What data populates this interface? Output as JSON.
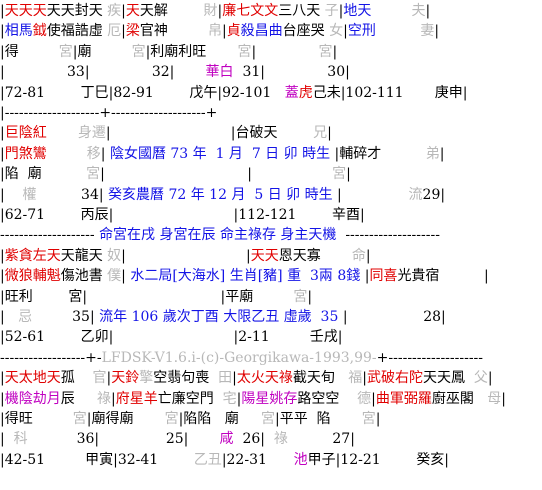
{
  "colors": {
    "red": "#e00000",
    "blue": "#1414e6",
    "green": "#00a000",
    "magenta": "#c000c0",
    "grey": "#b8b8b8",
    "black": "#000000"
  },
  "rows": [
    {
      "t": "━",
      "segs": [
        [
          "",
          "k"
        ]
      ]
    },
    {
      "segs": [
        [
          "|",
          "k"
        ],
        [
          "天天天",
          "r"
        ],
        [
          "天天封天 ",
          "k"
        ],
        [
          "疾",
          "g"
        ],
        [
          "|",
          "k"
        ],
        [
          "天",
          "r"
        ],
        [
          "天解        ",
          "k"
        ],
        [
          "財",
          "g"
        ],
        [
          "|",
          "k"
        ],
        [
          "廉七文文",
          "r"
        ],
        [
          "三八天 ",
          "k"
        ],
        [
          "子",
          "g"
        ],
        [
          "|",
          "k"
        ],
        [
          "地天         ",
          "b"
        ],
        [
          "夫",
          "g"
        ],
        [
          "|",
          "k"
        ]
      ]
    },
    {
      "segs": [
        [
          "|",
          "k"
        ],
        [
          "相馬",
          "b"
        ],
        [
          "鉞",
          "r"
        ],
        [
          "使福誥虛 ",
          "k"
        ],
        [
          "厄",
          "g"
        ],
        [
          "|",
          "k"
        ],
        [
          "梁",
          "r"
        ],
        [
          "官神         ",
          "k"
        ],
        [
          "帛",
          "g"
        ],
        [
          "|",
          "k"
        ],
        [
          "貞",
          "r"
        ],
        [
          "殺昌曲",
          "b"
        ],
        [
          "台座哭 ",
          "k"
        ],
        [
          "女",
          "g"
        ],
        [
          "|",
          "k"
        ],
        [
          "空刑          ",
          "b"
        ],
        [
          "妻",
          "g"
        ],
        [
          "|",
          "k"
        ]
      ]
    },
    {
      "segs": [
        [
          "|得         ",
          "k"
        ],
        [
          "宮",
          "g"
        ],
        [
          "|廟         ",
          "k"
        ],
        [
          "宮",
          "g"
        ],
        [
          "|利廟利旺       ",
          "k"
        ],
        [
          "宮",
          "g"
        ],
        [
          "|              ",
          "k"
        ],
        [
          "宮",
          "g"
        ],
        [
          "|",
          "k"
        ]
      ]
    },
    {
      "segs": [
        [
          "|              33|              32|       ",
          "k"
        ],
        [
          "華白",
          "m"
        ],
        [
          "  31|              30|",
          "k"
        ]
      ]
    },
    {
      "segs": [
        [
          "|72-81        丁巳|82-91        戊午|92-101   ",
          "k"
        ],
        [
          "蓋",
          "m"
        ],
        [
          "虎",
          "r"
        ],
        [
          "己未|102-111       庚申|",
          "k"
        ]
      ]
    },
    {
      "segs": [
        [
          "|--------------------+--------------------+",
          "k"
        ]
      ]
    },
    {
      "segs": [
        [
          "|",
          "k"
        ],
        [
          "巨陰紅",
          "r"
        ],
        [
          "       ",
          "k"
        ],
        [
          "身遷",
          "g"
        ],
        [
          "|                           |台破天        ",
          "k"
        ],
        [
          "兄",
          "g"
        ],
        [
          "|",
          "k"
        ]
      ]
    },
    {
      "segs": [
        [
          "|",
          "k"
        ],
        [
          "門煞鸞",
          "r"
        ],
        [
          "         ",
          "k"
        ],
        [
          "移",
          "g"
        ],
        [
          "| ",
          "k"
        ],
        [
          "陰女國曆 73 年  1 月  7 日 卯 時生",
          "b"
        ],
        [
          " |輔碎才          ",
          "k"
        ],
        [
          "弟",
          "g"
        ],
        [
          "|",
          "k"
        ]
      ]
    },
    {
      "segs": [
        [
          "|陷  廟          ",
          "k"
        ],
        [
          "宮",
          "g"
        ],
        [
          "|                                |                  ",
          "k"
        ],
        [
          "宮",
          "g"
        ],
        [
          "|",
          "k"
        ]
      ]
    },
    {
      "segs": [
        [
          "|    ",
          "k"
        ],
        [
          "權",
          "g"
        ],
        [
          "          34| ",
          "k"
        ],
        [
          "癸亥農曆 72 年 12 月  5 日 卯 時生",
          "b"
        ],
        [
          " |               ",
          "k"
        ],
        [
          "流",
          "g"
        ],
        [
          "29|",
          "k"
        ]
      ]
    },
    {
      "segs": [
        [
          "|62-71        丙辰|                           |112-121        辛酉|",
          "k"
        ]
      ]
    },
    {
      "segs": [
        [
          "-------------------- ",
          "k"
        ],
        [
          "命宮在戌 身宮在辰 命主祿存 身主天機",
          "b"
        ],
        [
          "  --------------------",
          "k"
        ]
      ]
    },
    {
      "segs": [
        [
          "|",
          "k"
        ],
        [
          "紫貪左天",
          "r"
        ],
        [
          "天龍天 ",
          "k"
        ],
        [
          "奴",
          "g"
        ],
        [
          "|                           |",
          "k"
        ],
        [
          "天天",
          "r"
        ],
        [
          "恩天寡       ",
          "k"
        ],
        [
          "命",
          "g"
        ],
        [
          "|",
          "k"
        ]
      ]
    },
    {
      "segs": [
        [
          "|",
          "k"
        ],
        [
          "微狼輔魁",
          "r"
        ],
        [
          "傷池書 ",
          "k"
        ],
        [
          "僕",
          "g"
        ],
        [
          "| ",
          "k"
        ],
        [
          "水二局[大海水] 生肖[豬] 重  3兩 8錢",
          "b"
        ],
        [
          " |",
          "k"
        ],
        [
          "同喜",
          "r"
        ],
        [
          "光貴宿          ",
          "k"
        ],
        [
          "|",
          "k"
        ]
      ]
    },
    {
      "segs": [
        [
          "|旺利        宮|                              |平廟         ",
          "k"
        ],
        [
          "宮",
          "g"
        ],
        [
          "|",
          "k"
        ]
      ]
    },
    {
      "segs": [
        [
          "|   ",
          "k"
        ],
        [
          "忌",
          "g"
        ],
        [
          "         35| ",
          "k"
        ],
        [
          "流年 106 歲次丁酉 大限乙丑 虛歲  35",
          "b"
        ],
        [
          " |                 28|",
          "k"
        ]
      ]
    },
    {
      "segs": [
        [
          "|52-61        乙卯|                           |2-11         壬戌|",
          "k"
        ]
      ]
    },
    {
      "segs": [
        [
          "------------------+-",
          "k"
        ],
        [
          "LFDSK-V1.6.i-(c)-Georgikawa-1993,99-",
          "g"
        ],
        [
          "+--------------------",
          "k"
        ]
      ]
    },
    {
      "segs": [
        [
          "|",
          "k"
        ],
        [
          "天太地天",
          "r"
        ],
        [
          "孤    ",
          "k"
        ],
        [
          "官",
          "g"
        ],
        [
          "|",
          "k"
        ],
        [
          "天鈴",
          "r"
        ],
        [
          "擎",
          "g"
        ],
        [
          "空翡句喪  ",
          "k"
        ],
        [
          "田",
          "g"
        ],
        [
          "|",
          "k"
        ],
        [
          "太火天祿",
          "r"
        ],
        [
          "截天旬   ",
          "k"
        ],
        [
          "福",
          "g"
        ],
        [
          "|",
          "k"
        ],
        [
          "武破右陀",
          "r"
        ],
        [
          "天天鳳  ",
          "k"
        ],
        [
          "父",
          "g"
        ],
        [
          "|",
          "k"
        ]
      ]
    },
    {
      "segs": [
        [
          "|",
          "k"
        ],
        [
          "機陰劫月",
          "m"
        ],
        [
          "辰     ",
          "k"
        ],
        [
          "祿",
          "g"
        ],
        [
          "|",
          "k"
        ],
        [
          "府星羊",
          "r"
        ],
        [
          "亡廉空門  ",
          "k"
        ],
        [
          "宅",
          "g"
        ],
        [
          "|",
          "k"
        ],
        [
          "陽星姚存",
          "m"
        ],
        [
          "路空空    ",
          "k"
        ],
        [
          "德",
          "g"
        ],
        [
          "|",
          "k"
        ],
        [
          "曲軍弼羅",
          "r"
        ],
        [
          "廚巫閣   ",
          "k"
        ],
        [
          "母",
          "g"
        ],
        [
          "|",
          "k"
        ]
      ]
    },
    {
      "segs": [
        [
          "|得旺         ",
          "k"
        ],
        [
          "宮",
          "g"
        ],
        [
          "|廟得廟       ",
          "k"
        ],
        [
          "宮",
          "g"
        ],
        [
          "|陷陷   廟     ",
          "k"
        ],
        [
          "宮",
          "g"
        ],
        [
          "|平平  陷       ",
          "k"
        ],
        [
          "宮",
          "g"
        ],
        [
          "|",
          "k"
        ]
      ]
    },
    {
      "segs": [
        [
          "|  ",
          "k"
        ],
        [
          "科",
          "g"
        ],
        [
          "           36|               25|       ",
          "k"
        ],
        [
          "咸",
          "m"
        ],
        [
          "  26|  ",
          "k"
        ],
        [
          "祿",
          "g"
        ],
        [
          "          27|",
          "k"
        ]
      ]
    },
    {
      "segs": [
        [
          "|42-51         甲寅|32-41        ",
          "k"
        ],
        [
          "乙丑",
          "g"
        ],
        [
          "|22-31      ",
          "k"
        ],
        [
          "池",
          "m"
        ],
        [
          "甲子|12-21        癸亥|",
          "k"
        ]
      ]
    }
  ]
}
